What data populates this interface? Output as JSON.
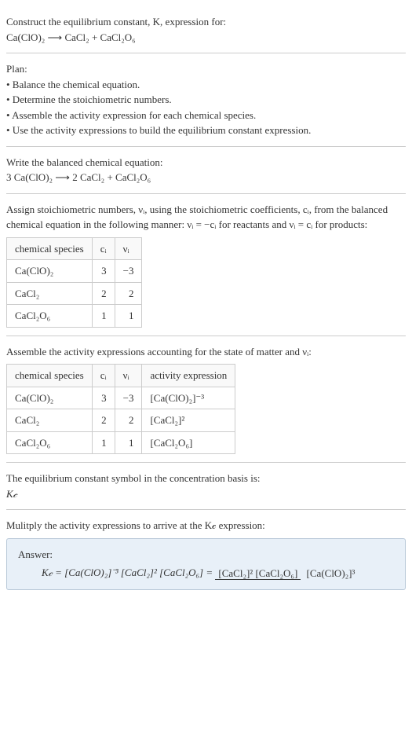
{
  "intro": {
    "line1": "Construct the equilibrium constant, K, expression for:",
    "eq": "Ca(ClO)₂ ⟶ CaCl₂ + CaCl₂O₆"
  },
  "plan": {
    "header": "Plan:",
    "bullets": [
      "• Balance the chemical equation.",
      "• Determine the stoichiometric numbers.",
      "• Assemble the activity expression for each chemical species.",
      "• Use the activity expressions to build the equilibrium constant expression."
    ]
  },
  "balanced": {
    "header": "Write the balanced chemical equation:",
    "eq": "3 Ca(ClO)₂ ⟶ 2 CaCl₂ + CaCl₂O₆"
  },
  "assign": {
    "text": "Assign stoichiometric numbers, νᵢ, using the stoichiometric coefficients, cᵢ, from the balanced chemical equation in the following manner: νᵢ = −cᵢ for reactants and νᵢ = cᵢ for products:",
    "headers": [
      "chemical species",
      "cᵢ",
      "νᵢ"
    ],
    "rows": [
      [
        "Ca(ClO)₂",
        "3",
        "−3"
      ],
      [
        "CaCl₂",
        "2",
        "2"
      ],
      [
        "CaCl₂O₆",
        "1",
        "1"
      ]
    ]
  },
  "activity": {
    "text": "Assemble the activity expressions accounting for the state of matter and νᵢ:",
    "headers": [
      "chemical species",
      "cᵢ",
      "νᵢ",
      "activity expression"
    ],
    "rows": [
      [
        "Ca(ClO)₂",
        "3",
        "−3",
        "[Ca(ClO)₂]⁻³"
      ],
      [
        "CaCl₂",
        "2",
        "2",
        "[CaCl₂]²"
      ],
      [
        "CaCl₂O₆",
        "1",
        "1",
        "[CaCl₂O₆]"
      ]
    ]
  },
  "symbol": {
    "line1": "The equilibrium constant symbol in the concentration basis is:",
    "line2": "K𝒸"
  },
  "multiply": {
    "text": "Mulitply the activity expressions to arrive at the K𝒸 expression:"
  },
  "answer": {
    "label": "Answer:",
    "lhs": "K𝒸 = [Ca(ClO)₂]⁻³ [CaCl₂]² [CaCl₂O₆] = ",
    "num": "[CaCl₂]² [CaCl₂O₆]",
    "den": "[Ca(ClO)₂]³"
  }
}
